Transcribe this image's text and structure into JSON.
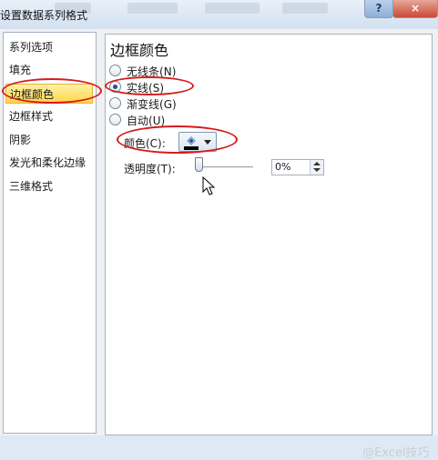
{
  "window": {
    "title": "设置数据系列格式",
    "help_label": "?",
    "close_label": "×"
  },
  "nav": {
    "items": [
      {
        "label": "系列选项"
      },
      {
        "label": "填充"
      },
      {
        "label": "边框颜色"
      },
      {
        "label": "边框样式"
      },
      {
        "label": "阴影"
      },
      {
        "label": "发光和柔化边缘"
      },
      {
        "label": "三维格式"
      }
    ],
    "selected": "边框颜色"
  },
  "panel": {
    "title": "边框颜色",
    "options": [
      {
        "label": "无线条",
        "key": "N",
        "checked": false
      },
      {
        "label": "实线",
        "key": "S",
        "checked": true
      },
      {
        "label": "渐变线",
        "key": "G",
        "checked": false
      },
      {
        "label": "自动",
        "key": "U",
        "checked": false
      }
    ],
    "color_label": "颜色(C):",
    "transparency_label": "透明度(T):",
    "transparency_value": "0%",
    "transparency_percent": 0
  },
  "watermark": "@Excel技巧",
  "colors": {
    "highlight": "#d51b1b",
    "selected_bg": "#ffd64a",
    "swatch": "#000000"
  },
  "icons": {
    "paint_bucket": "paint-bucket-icon",
    "dropdown": "chevron-down-icon",
    "cursor": "mouse-pointer-icon"
  }
}
